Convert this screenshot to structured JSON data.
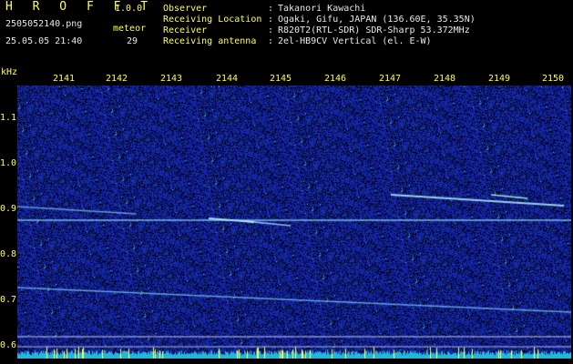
{
  "app": {
    "title": "H R O F F T",
    "version": "1.0.0",
    "filename": "2505052140.png",
    "datetime": "25.05.05 21:40",
    "meteor_label": "meteor",
    "meteor_count": "29"
  },
  "info": [
    {
      "label": "Observer",
      "value": "Takanori Kawachi"
    },
    {
      "label": "Receiving Location",
      "value": "Ogaki, Gifu, JAPAN (136.60E, 35.35N)"
    },
    {
      "label": "Receiver",
      "value": "R820T2(RTL-SDR) SDR-Sharp 53.372MHz"
    },
    {
      "label": "Receiving antenna",
      "value": "2el-HB9CV Vertical (el. E-W)"
    }
  ],
  "axis": {
    "unit": "kHz",
    "x_ticks": [
      "2141",
      "2142",
      "2143",
      "2144",
      "2145",
      "2146",
      "2147",
      "2148",
      "2149",
      "2150"
    ],
    "y_ticks": [
      "1.1",
      "1.0",
      "0.9",
      "0.8",
      "0.7",
      "0.6"
    ]
  },
  "colors": {
    "background": "#000000",
    "label": "#ffff4d",
    "noise": "#1a2a9c",
    "signal": "#9fd8ff"
  }
}
